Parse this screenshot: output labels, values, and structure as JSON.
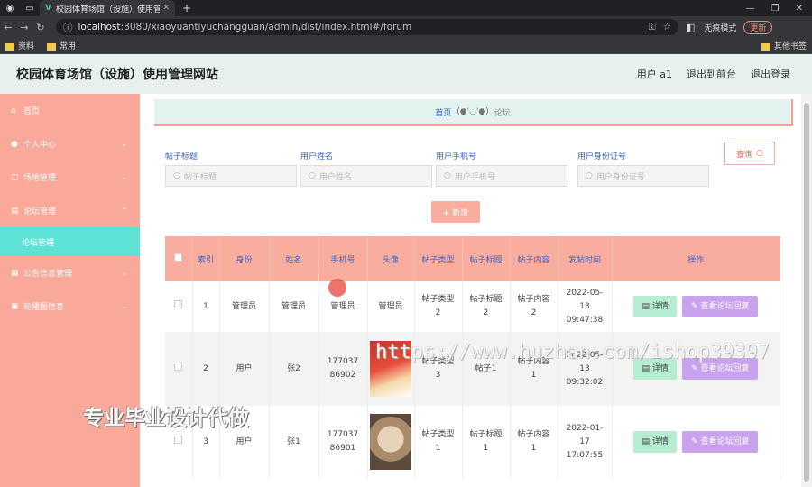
{
  "browser": {
    "tab_title": "校园体育场馆（设施）使用管理网站",
    "url_host": "localhost",
    "url_rest": ":8080/xiaoyuantiyuchangguan/admin/dist/index.html#/forum",
    "incognito_label": "无痕模式",
    "update_label": "更新",
    "bookmarks": [
      "资料",
      "常用"
    ],
    "other_bookmarks": "其他书签"
  },
  "header": {
    "title": "校园体育场馆（设施）使用管理网站",
    "user": "用户 a1",
    "back_link": "退出到前台",
    "logout_link": "退出登录"
  },
  "sidebar": {
    "items": [
      {
        "label": "首页",
        "icon": "home-icon"
      },
      {
        "label": "个人中心",
        "icon": "user-icon"
      },
      {
        "label": "场地管理",
        "icon": "venue-icon"
      },
      {
        "label": "论坛管理",
        "icon": "forum-icon"
      },
      {
        "label": "论坛管理",
        "icon": ""
      },
      {
        "label": "公告信息管理",
        "icon": "grid-icon"
      },
      {
        "label": "轮播图信息",
        "icon": "image-icon"
      }
    ]
  },
  "breadcrumb": {
    "home": "首页",
    "emoticon": "(●'◡'●)",
    "current": "论坛"
  },
  "filters": {
    "title_label": "帖子标题",
    "title_placeholder": "帖子标题",
    "name_label": "用户姓名",
    "name_placeholder": "用户姓名",
    "phone_label": "用户手机号",
    "phone_placeholder": "用户手机号",
    "idcard_label": "用户身份证号",
    "idcard_placeholder": "用户身份证号",
    "query_button": "查询"
  },
  "add_button": "+ 新增",
  "table": {
    "headers": [
      "索引",
      "身份",
      "姓名",
      "手机号",
      "头像",
      "帖子类型",
      "帖子标题",
      "帖子内容",
      "发帖时间",
      "操作"
    ],
    "rows": [
      {
        "index": "1",
        "role": "管理员",
        "name": "管理员",
        "phone": "管理员",
        "avatar": "管理员",
        "type": "帖子类型 2",
        "title": "帖子标题 2",
        "content": "帖子内容 2",
        "time": "2022-05-13 09:47:38"
      },
      {
        "index": "2",
        "role": "用户",
        "name": "张2",
        "phone": "17703786902",
        "avatar": "",
        "type": "帖子类型 3",
        "title": "帖子1",
        "content": "帖子内容 1",
        "time": "2022-05-13 09:32:02"
      },
      {
        "index": "3",
        "role": "用户",
        "name": "张1",
        "phone": "17703786901",
        "avatar": "",
        "type": "帖子类型 1",
        "title": "帖子标题 1",
        "content": "帖子内容 1",
        "time": "2022-01-17 17:07:55"
      }
    ],
    "detail_button": "详情",
    "reply_button": "查看论坛回复"
  },
  "overlay": {
    "watermark_url": "https://www.huzhan.com/ishop39397",
    "watermark_text": "专业毕业设计代做"
  }
}
